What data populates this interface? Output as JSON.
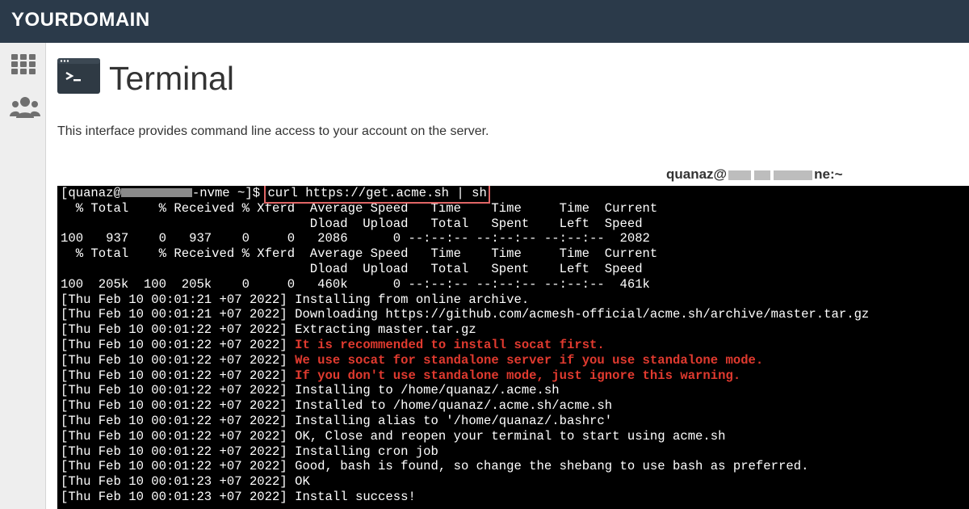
{
  "header": {
    "brand": "YOURDOMAIN"
  },
  "sidebar": {
    "icons": [
      "grid-icon",
      "users-icon"
    ]
  },
  "page": {
    "title": "Terminal",
    "description": "This interface provides command line access to your account on the server.",
    "host_label_start": "quanaz@",
    "host_label_end": "ne:~"
  },
  "terminal": {
    "prompt_user": "[quanaz@",
    "prompt_suffix": "-nvme ~]$ ",
    "command": "curl https://get.acme.sh | sh",
    "lines": [
      {
        "text": "  % Total    % Received % Xferd  Average Speed   Time    Time     Time  Current",
        "red": false
      },
      {
        "text": "                                 Dload  Upload   Total   Spent    Left  Speed",
        "red": false
      },
      {
        "text": "100   937    0   937    0     0   2086      0 --:--:-- --:--:-- --:--:--  2082",
        "red": false
      },
      {
        "text": "  % Total    % Received % Xferd  Average Speed   Time    Time     Time  Current",
        "red": false
      },
      {
        "text": "                                 Dload  Upload   Total   Spent    Left  Speed",
        "red": false
      },
      {
        "text": "100  205k  100  205k    0     0   460k      0 --:--:-- --:--:-- --:--:--  461k",
        "red": false
      },
      {
        "prefix": "[Thu Feb 10 00:01:21 +07 2022] ",
        "text": "Installing from online archive.",
        "red": false
      },
      {
        "prefix": "[Thu Feb 10 00:01:21 +07 2022] ",
        "text": "Downloading https://github.com/acmesh-official/acme.sh/archive/master.tar.gz",
        "red": false
      },
      {
        "prefix": "[Thu Feb 10 00:01:22 +07 2022] ",
        "text": "Extracting master.tar.gz",
        "red": false
      },
      {
        "prefix": "[Thu Feb 10 00:01:22 +07 2022] ",
        "text": "It is recommended to install socat first.",
        "red": true
      },
      {
        "prefix": "[Thu Feb 10 00:01:22 +07 2022] ",
        "text": "We use socat for standalone server if you use standalone mode.",
        "red": true
      },
      {
        "prefix": "[Thu Feb 10 00:01:22 +07 2022] ",
        "text": "If you don't use standalone mode, just ignore this warning.",
        "red": true
      },
      {
        "prefix": "[Thu Feb 10 00:01:22 +07 2022] ",
        "text": "Installing to /home/quanaz/.acme.sh",
        "red": false
      },
      {
        "prefix": "[Thu Feb 10 00:01:22 +07 2022] ",
        "text": "Installed to /home/quanaz/.acme.sh/acme.sh",
        "red": false
      },
      {
        "prefix": "[Thu Feb 10 00:01:22 +07 2022] ",
        "text": "Installing alias to '/home/quanaz/.bashrc'",
        "red": false
      },
      {
        "prefix": "[Thu Feb 10 00:01:22 +07 2022] ",
        "text": "OK, Close and reopen your terminal to start using acme.sh",
        "red": false
      },
      {
        "prefix": "[Thu Feb 10 00:01:22 +07 2022] ",
        "text": "Installing cron job",
        "red": false
      },
      {
        "prefix": "[Thu Feb 10 00:01:22 +07 2022] ",
        "text": "Good, bash is found, so change the shebang to use bash as preferred.",
        "red": false
      },
      {
        "prefix": "[Thu Feb 10 00:01:23 +07 2022] ",
        "text": "OK",
        "red": false
      },
      {
        "prefix": "[Thu Feb 10 00:01:23 +07 2022] ",
        "text": "Install success!",
        "red": false
      }
    ]
  },
  "colors": {
    "topbar": "#2b3a4a",
    "warning": "#e03a2f",
    "highlight": "#e06666"
  }
}
